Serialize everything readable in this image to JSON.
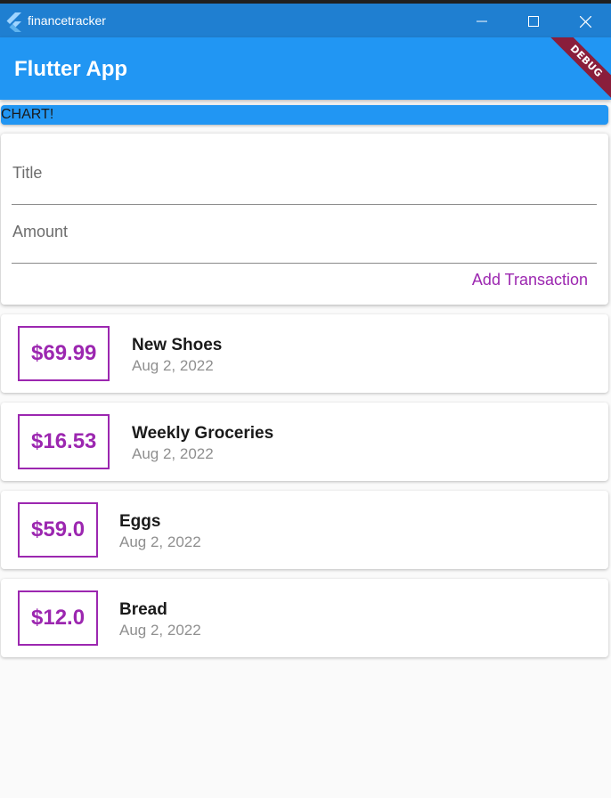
{
  "window": {
    "title": "financetracker",
    "icon": "flutter-icon",
    "controls": [
      "minimize-icon",
      "maximize-icon",
      "close-icon"
    ]
  },
  "appbar": {
    "title": "Flutter App",
    "debug_label": "DEBUG",
    "color": "#2196f3"
  },
  "chart": {
    "label": "CHART!"
  },
  "form": {
    "title_placeholder": "Title",
    "amount_placeholder": "Amount",
    "title_value": "",
    "amount_value": "",
    "submit_label": "Add Transaction",
    "accent": "#9c27b0"
  },
  "transactions": [
    {
      "amount": "$69.99",
      "title": "New Shoes",
      "date": "Aug 2, 2022"
    },
    {
      "amount": "$16.53",
      "title": "Weekly Groceries",
      "date": "Aug 2, 2022"
    },
    {
      "amount": "$59.0",
      "title": "Eggs",
      "date": "Aug 2, 2022"
    },
    {
      "amount": "$12.0",
      "title": "Bread",
      "date": "Aug 2, 2022"
    }
  ]
}
